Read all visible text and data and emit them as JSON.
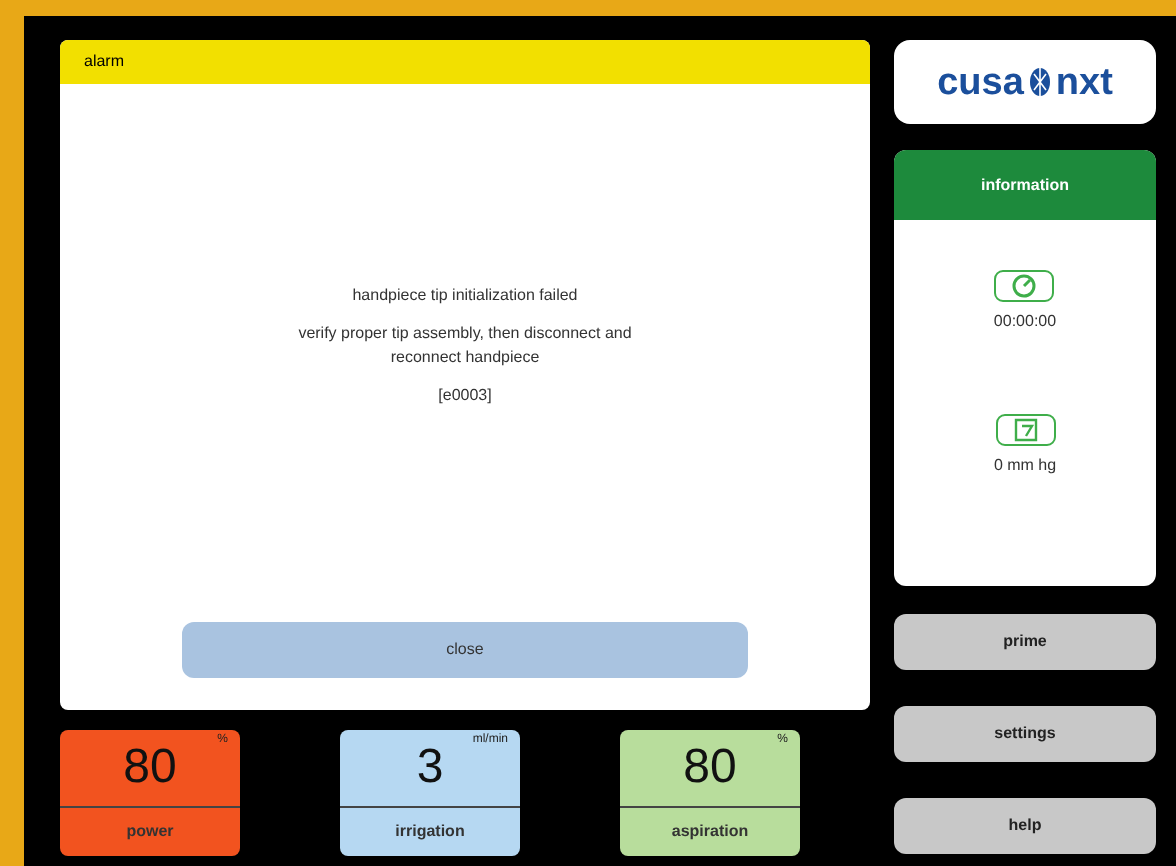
{
  "alarm": {
    "title": "alarm",
    "lines": [
      "handpiece tip initialization failed",
      "verify proper tip assembly, then disconnect and reconnect handpiece",
      "[e0003]"
    ],
    "close_button": "close"
  },
  "logo": {
    "left": "cusa",
    "right": "nxt"
  },
  "information": {
    "title": "information",
    "items": [
      {
        "kind": "timer",
        "value": "00:00:00"
      },
      {
        "kind": "pressure",
        "value": "0 mm hg"
      }
    ]
  },
  "buttons": [
    "prime",
    "settings",
    "help"
  ],
  "tiles": [
    {
      "kind": "power",
      "value": "80",
      "unit": "%",
      "label": "power"
    },
    {
      "kind": "irrigation",
      "value": "3",
      "unit": "ml/min",
      "label": "irrigation"
    },
    {
      "kind": "aspiration",
      "value": "80",
      "unit": "%",
      "label": "aspiration"
    }
  ]
}
